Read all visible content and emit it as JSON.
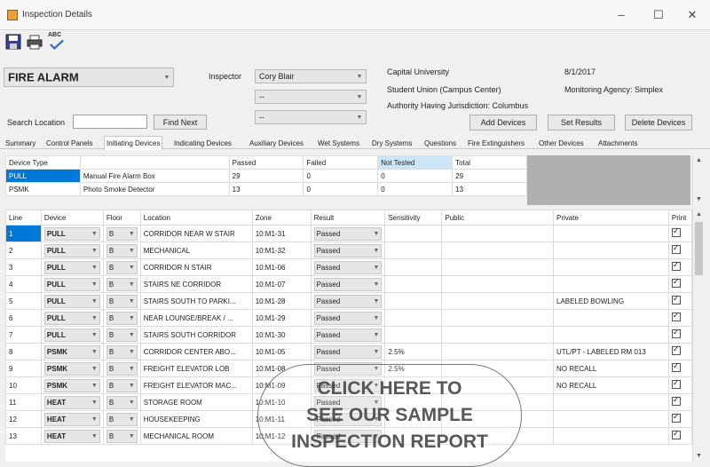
{
  "window": {
    "title": "Inspection Details",
    "minimize": "–",
    "maximize": "☐",
    "close": "✕"
  },
  "toolbar": {
    "icons": [
      "save-icon",
      "print-icon",
      "spell-check-icon"
    ],
    "spell_label": "ABC"
  },
  "header": {
    "system_type": "FIRE ALARM",
    "inspector_label": "Inspector",
    "inspector_value": "Cory Blair",
    "inspector2_value": "--",
    "inspector3_value": "--",
    "search_label": "Search Location",
    "search_value": "",
    "find_next": "Find Next",
    "customer": "Capital University",
    "building": "Student Union (Campus Center)",
    "authority": "Authority Having Jurisdiction: Columbus",
    "date": "8/1/2017",
    "monitoring": "Monitoring Agency: Simplex",
    "add_devices": "Add Devices",
    "set_results": "Set Results",
    "delete_devices": "Delete Devices"
  },
  "tabs": [
    {
      "label": "Summary"
    },
    {
      "label": "Control Panels"
    },
    {
      "label": "Initiating Devices"
    },
    {
      "label": "Indicating Devices"
    },
    {
      "label": "Auxiliary Devices"
    },
    {
      "label": "Wet Systems"
    },
    {
      "label": "Dry Systems"
    },
    {
      "label": "Questions"
    },
    {
      "label": "Fire Extinguishers"
    },
    {
      "label": "Other Devices"
    },
    {
      "label": "Attachments"
    }
  ],
  "summary": {
    "headers": [
      "Device Type",
      "",
      "Passed",
      "Failed",
      "Not Tested",
      "Total"
    ],
    "rows": [
      [
        "PULL",
        "Manual Fire Alarm Box",
        "29",
        "0",
        "0",
        "29"
      ],
      [
        "PSMK",
        "Photo Smoke Detector",
        "13",
        "0",
        "0",
        "13"
      ]
    ]
  },
  "grid": {
    "headers": [
      "Line",
      "Device",
      "Floor",
      "Location",
      "Zone",
      "Result",
      "Sensitivity",
      "Public",
      "Private",
      "Print"
    ],
    "rows": [
      [
        "1",
        "PULL",
        "B",
        "CORRIDOR NEAR W STAIR",
        "10:M1-31",
        "Passed",
        "",
        "",
        ""
      ],
      [
        "2",
        "PULL",
        "B",
        "MECHANICAL",
        "10:M1-32",
        "Passed",
        "",
        "",
        ""
      ],
      [
        "3",
        "PULL",
        "B",
        "CORRIDOR N STAIR",
        "10:M1-06",
        "Passed",
        "",
        "",
        ""
      ],
      [
        "4",
        "PULL",
        "B",
        "STAIRS NE CORRIDOR",
        "10:M1-07",
        "Passed",
        "",
        "",
        ""
      ],
      [
        "5",
        "PULL",
        "B",
        "STAIRS SOUTH TO PARKI...",
        "10:M1-28",
        "Passed",
        "",
        "",
        "LABELED BOWLING"
      ],
      [
        "6",
        "PULL",
        "B",
        "NEAR LOUNGE/BREAK / ...",
        "10:M1-29",
        "Passed",
        "",
        "",
        ""
      ],
      [
        "7",
        "PULL",
        "B",
        "STAIRS SOUTH CORRIDOR",
        "10:M1-30",
        "Passed",
        "",
        "",
        ""
      ],
      [
        "8",
        "PSMK",
        "B",
        "CORRIDOR CENTER ABO...",
        "10:M1-05",
        "Passed",
        "2.5%",
        "",
        "UTL/PT - LABELED RM 013"
      ],
      [
        "9",
        "PSMK",
        "B",
        "FREIGHT ELEVATOR LOB",
        "10:M1-08",
        "Passed",
        "2.5%",
        "",
        "NO RECALL"
      ],
      [
        "10",
        "PSMK",
        "B",
        "FREIGHT ELEVATOR MAC...",
        "10:M1-09",
        "Passed",
        "",
        "",
        "NO RECALL"
      ],
      [
        "11",
        "HEAT",
        "B",
        "STORAGE ROOM",
        "10:M1-10",
        "Passed",
        "",
        "",
        ""
      ],
      [
        "12",
        "HEAT",
        "B",
        "HOUSEKEEPING",
        "10:M1-11",
        "Passed",
        "",
        "",
        ""
      ],
      [
        "13",
        "HEAT",
        "B",
        "MECHANICAL ROOM",
        "10:M1-12",
        "Passed",
        "",
        "",
        ""
      ]
    ]
  },
  "overlay": {
    "line1": "CLICK HERE TO",
    "line2": "SEE OUR SAMPLE",
    "line3": "INSPECTION REPORT"
  },
  "colors": {
    "selection": "#0078d7",
    "header_highlight": "#cde6f7"
  }
}
